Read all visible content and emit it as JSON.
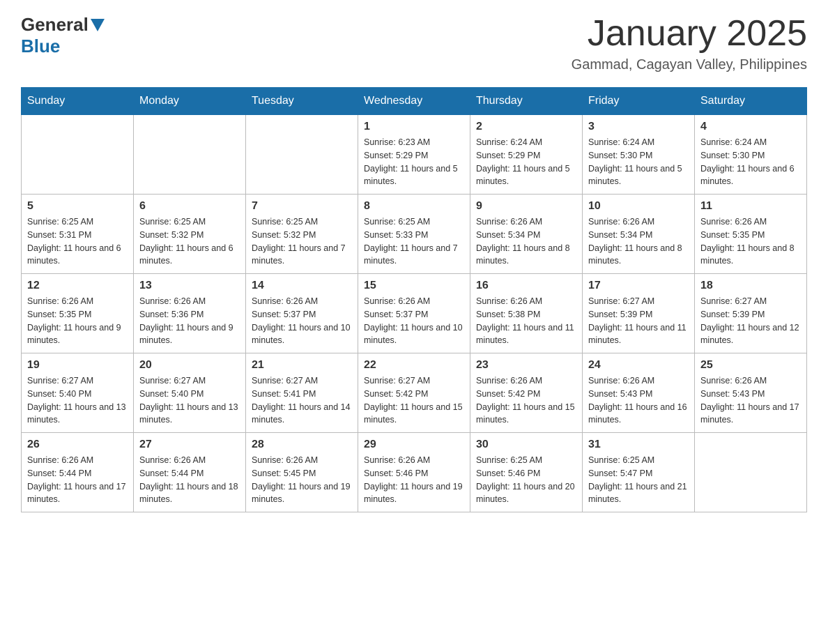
{
  "header": {
    "logo": {
      "general": "General",
      "blue": "Blue"
    },
    "title": "January 2025",
    "location": "Gammad, Cagayan Valley, Philippines"
  },
  "calendar": {
    "days_of_week": [
      "Sunday",
      "Monday",
      "Tuesday",
      "Wednesday",
      "Thursday",
      "Friday",
      "Saturday"
    ],
    "weeks": [
      {
        "cells": [
          {
            "day": "",
            "info": ""
          },
          {
            "day": "",
            "info": ""
          },
          {
            "day": "",
            "info": ""
          },
          {
            "day": "1",
            "info": "Sunrise: 6:23 AM\nSunset: 5:29 PM\nDaylight: 11 hours and 5 minutes."
          },
          {
            "day": "2",
            "info": "Sunrise: 6:24 AM\nSunset: 5:29 PM\nDaylight: 11 hours and 5 minutes."
          },
          {
            "day": "3",
            "info": "Sunrise: 6:24 AM\nSunset: 5:30 PM\nDaylight: 11 hours and 5 minutes."
          },
          {
            "day": "4",
            "info": "Sunrise: 6:24 AM\nSunset: 5:30 PM\nDaylight: 11 hours and 6 minutes."
          }
        ]
      },
      {
        "cells": [
          {
            "day": "5",
            "info": "Sunrise: 6:25 AM\nSunset: 5:31 PM\nDaylight: 11 hours and 6 minutes."
          },
          {
            "day": "6",
            "info": "Sunrise: 6:25 AM\nSunset: 5:32 PM\nDaylight: 11 hours and 6 minutes."
          },
          {
            "day": "7",
            "info": "Sunrise: 6:25 AM\nSunset: 5:32 PM\nDaylight: 11 hours and 7 minutes."
          },
          {
            "day": "8",
            "info": "Sunrise: 6:25 AM\nSunset: 5:33 PM\nDaylight: 11 hours and 7 minutes."
          },
          {
            "day": "9",
            "info": "Sunrise: 6:26 AM\nSunset: 5:34 PM\nDaylight: 11 hours and 8 minutes."
          },
          {
            "day": "10",
            "info": "Sunrise: 6:26 AM\nSunset: 5:34 PM\nDaylight: 11 hours and 8 minutes."
          },
          {
            "day": "11",
            "info": "Sunrise: 6:26 AM\nSunset: 5:35 PM\nDaylight: 11 hours and 8 minutes."
          }
        ]
      },
      {
        "cells": [
          {
            "day": "12",
            "info": "Sunrise: 6:26 AM\nSunset: 5:35 PM\nDaylight: 11 hours and 9 minutes."
          },
          {
            "day": "13",
            "info": "Sunrise: 6:26 AM\nSunset: 5:36 PM\nDaylight: 11 hours and 9 minutes."
          },
          {
            "day": "14",
            "info": "Sunrise: 6:26 AM\nSunset: 5:37 PM\nDaylight: 11 hours and 10 minutes."
          },
          {
            "day": "15",
            "info": "Sunrise: 6:26 AM\nSunset: 5:37 PM\nDaylight: 11 hours and 10 minutes."
          },
          {
            "day": "16",
            "info": "Sunrise: 6:26 AM\nSunset: 5:38 PM\nDaylight: 11 hours and 11 minutes."
          },
          {
            "day": "17",
            "info": "Sunrise: 6:27 AM\nSunset: 5:39 PM\nDaylight: 11 hours and 11 minutes."
          },
          {
            "day": "18",
            "info": "Sunrise: 6:27 AM\nSunset: 5:39 PM\nDaylight: 11 hours and 12 minutes."
          }
        ]
      },
      {
        "cells": [
          {
            "day": "19",
            "info": "Sunrise: 6:27 AM\nSunset: 5:40 PM\nDaylight: 11 hours and 13 minutes."
          },
          {
            "day": "20",
            "info": "Sunrise: 6:27 AM\nSunset: 5:40 PM\nDaylight: 11 hours and 13 minutes."
          },
          {
            "day": "21",
            "info": "Sunrise: 6:27 AM\nSunset: 5:41 PM\nDaylight: 11 hours and 14 minutes."
          },
          {
            "day": "22",
            "info": "Sunrise: 6:27 AM\nSunset: 5:42 PM\nDaylight: 11 hours and 15 minutes."
          },
          {
            "day": "23",
            "info": "Sunrise: 6:26 AM\nSunset: 5:42 PM\nDaylight: 11 hours and 15 minutes."
          },
          {
            "day": "24",
            "info": "Sunrise: 6:26 AM\nSunset: 5:43 PM\nDaylight: 11 hours and 16 minutes."
          },
          {
            "day": "25",
            "info": "Sunrise: 6:26 AM\nSunset: 5:43 PM\nDaylight: 11 hours and 17 minutes."
          }
        ]
      },
      {
        "cells": [
          {
            "day": "26",
            "info": "Sunrise: 6:26 AM\nSunset: 5:44 PM\nDaylight: 11 hours and 17 minutes."
          },
          {
            "day": "27",
            "info": "Sunrise: 6:26 AM\nSunset: 5:44 PM\nDaylight: 11 hours and 18 minutes."
          },
          {
            "day": "28",
            "info": "Sunrise: 6:26 AM\nSunset: 5:45 PM\nDaylight: 11 hours and 19 minutes."
          },
          {
            "day": "29",
            "info": "Sunrise: 6:26 AM\nSunset: 5:46 PM\nDaylight: 11 hours and 19 minutes."
          },
          {
            "day": "30",
            "info": "Sunrise: 6:25 AM\nSunset: 5:46 PM\nDaylight: 11 hours and 20 minutes."
          },
          {
            "day": "31",
            "info": "Sunrise: 6:25 AM\nSunset: 5:47 PM\nDaylight: 11 hours and 21 minutes."
          },
          {
            "day": "",
            "info": ""
          }
        ]
      }
    ]
  }
}
